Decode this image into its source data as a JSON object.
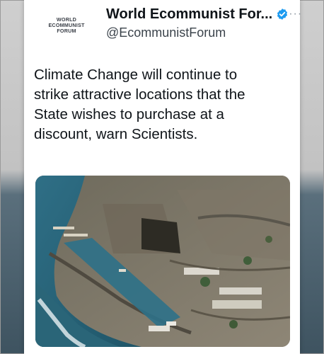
{
  "account": {
    "display_name": "World Ecommunist For...",
    "handle": "@EcommunistForum",
    "avatar_lines": [
      "WORLD",
      "ECOMMUNIST",
      "FORUM"
    ]
  },
  "tweet": {
    "text": "Climate Change will continue to\nstrike attractive locations that the\nState wishes to purchase at a\ndiscount, warn Scientists."
  },
  "more_menu": "···",
  "colors": {
    "verified_badge": "#1d9bf0",
    "text": "#0f1419",
    "secondary_text": "#3b434b"
  },
  "icons": {
    "verified": "verified-badge-icon",
    "more": "more-options-icon"
  }
}
